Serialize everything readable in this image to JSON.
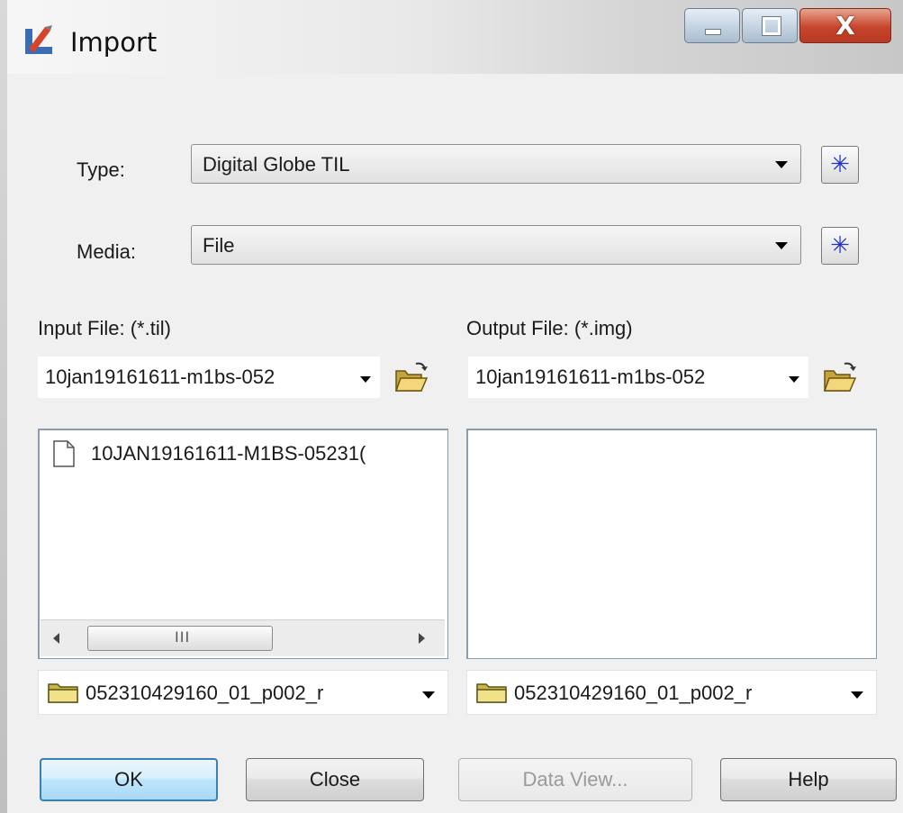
{
  "window": {
    "title": "Import",
    "colors": {
      "title_gradient_end": "#c7c7c7",
      "close": "#c6452c",
      "accent": "#2233cc"
    }
  },
  "form": {
    "type_label": "Type:",
    "type_value": "Digital Globe TIL",
    "media_label": "Media:",
    "media_value": "File",
    "icons": {
      "new": "asterisk-icon",
      "browse": "open-folder-icon",
      "file": "document-icon",
      "folder": "folder-icon"
    }
  },
  "input_panel": {
    "label": "Input File: (*.til)",
    "filename": "10jan19161611-m1bs-052",
    "list_items": [
      {
        "name": "10JAN19161611-M1BS-05231("
      }
    ],
    "scroll_thumb": "III",
    "directory": "052310429160_01_p002_r"
  },
  "output_panel": {
    "label": "Output File: (*.img)",
    "filename": "10jan19161611-m1bs-052",
    "directory": "052310429160_01_p002_r"
  },
  "buttons": {
    "ok": "OK",
    "close": "Close",
    "data_view": "Data View...",
    "help": "Help"
  }
}
